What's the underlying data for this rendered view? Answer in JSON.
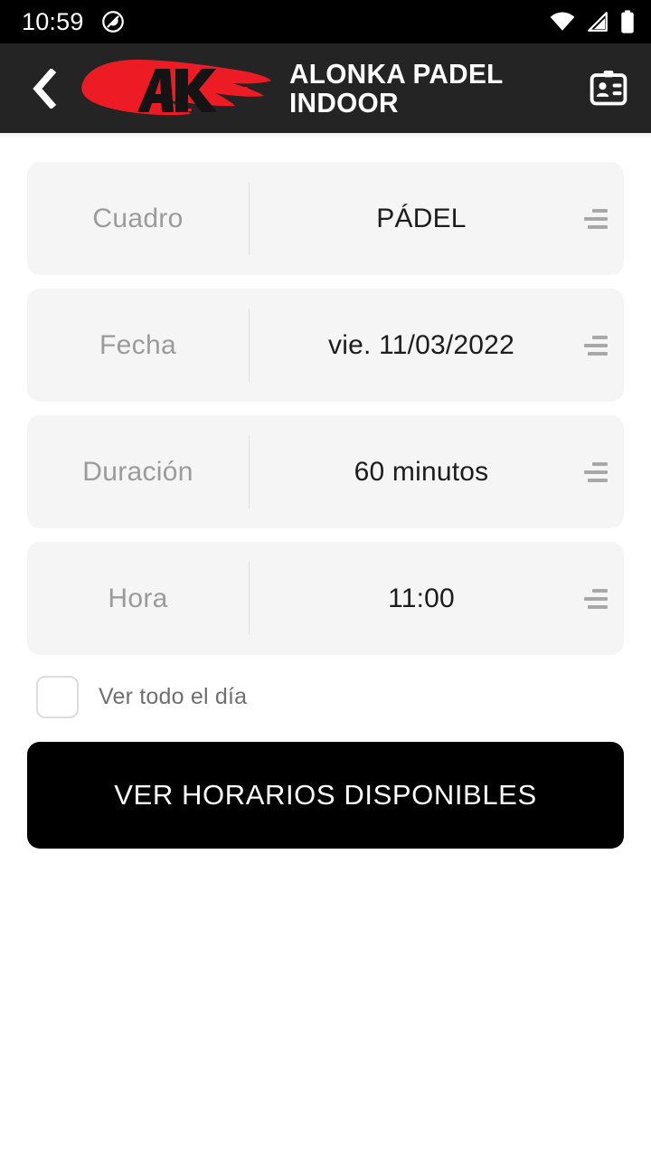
{
  "status_bar": {
    "time": "10:59",
    "icons": [
      "do-not-disturb-icon",
      "wifi-icon",
      "cell-signal-icon",
      "battery-icon"
    ],
    "background": "#000000"
  },
  "header": {
    "back_icon": "chevron-left-icon",
    "logo_alt": "AK",
    "title": "ALONKA PADEL INDOOR",
    "action_icon": "id-badge-icon",
    "background": "#242424",
    "logo_color": "#ED1C24"
  },
  "form": {
    "fields": [
      {
        "label": "Cuadro",
        "value": "PÁDEL",
        "icon": "list-select-icon"
      },
      {
        "label": "Fecha",
        "value": "vie. 11/03/2022",
        "icon": "list-select-icon"
      },
      {
        "label": "Duración",
        "value": "60 minutos",
        "icon": "list-select-icon"
      },
      {
        "label": "Hora",
        "value": "11:00",
        "icon": "list-select-icon"
      }
    ],
    "checkbox": {
      "label": "Ver todo el día",
      "checked": false
    },
    "submit_label": "VER HORARIOS DISPONIBLES"
  },
  "colors": {
    "page_background": "#FFFFFF",
    "card_background": "#F5F5F5",
    "label_text": "#9B9B9B",
    "value_text": "#1C1C1C",
    "button_background": "#000000",
    "button_text": "#FFFFFF",
    "accent_red": "#ED1C24"
  }
}
